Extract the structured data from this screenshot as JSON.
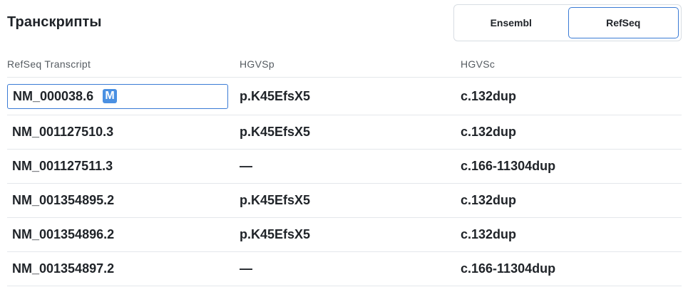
{
  "header": {
    "title": "Транскрипты"
  },
  "toggle": {
    "options": [
      {
        "label": "Ensembl",
        "active": false
      },
      {
        "label": "RefSeq",
        "active": true
      }
    ]
  },
  "table": {
    "columns": [
      "RefSeq Transcript",
      "HGVSp",
      "HGVSc"
    ],
    "rows": [
      {
        "transcript": "NM_000038.6",
        "badge": "M",
        "hgvsp": "p.K45EfsX5",
        "hgvsc": "c.132dup"
      },
      {
        "transcript": "NM_001127510.3",
        "hgvsp": "p.K45EfsX5",
        "hgvsc": "c.132dup"
      },
      {
        "transcript": "NM_001127511.3",
        "hgvsp": "—",
        "hgvsc": "c.166-11304dup"
      },
      {
        "transcript": "NM_001354895.2",
        "hgvsp": "p.K45EfsX5",
        "hgvsc": "c.132dup"
      },
      {
        "transcript": "NM_001354896.2",
        "hgvsp": "p.K45EfsX5",
        "hgvsc": "c.132dup"
      },
      {
        "transcript": "NM_001354897.2",
        "hgvsp": "—",
        "hgvsc": "c.166-11304dup"
      }
    ]
  },
  "colors": {
    "accent": "#3a7bd5",
    "badge": "#4a90e2",
    "divider": "#e4e7eb"
  }
}
